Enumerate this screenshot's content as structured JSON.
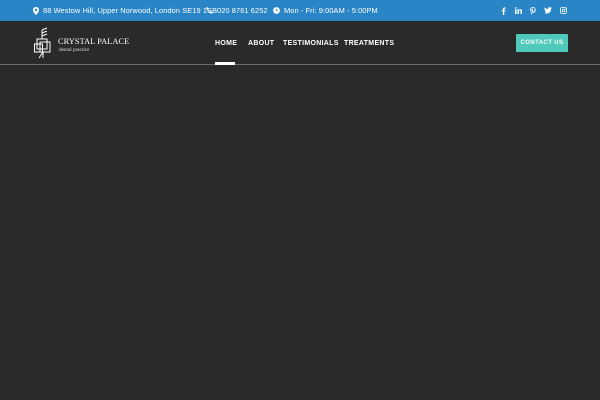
{
  "topbar": {
    "address": "88 Westow Hill, Upper Norwood, London SE19 1SB",
    "phone": "020 8761 6252",
    "hours": "Mon - Fri: 9:00AM - 5:00PM",
    "social": [
      "facebook-icon",
      "linkedin-icon",
      "pinterest-icon",
      "twitter-icon",
      "instagram-icon"
    ]
  },
  "header": {
    "logo_title": "CRYSTAL PALACE",
    "logo_subtitle": "dental practice",
    "nav": [
      "HOME",
      "ABOUT",
      "TESTIMONIALS",
      "TREATMENTS"
    ],
    "active_nav": "HOME",
    "cta_label": "CONTACT US"
  },
  "colors": {
    "topbar_bg": "#2a85c6",
    "page_bg": "#2a2a2a",
    "accent": "#4fc9bb"
  }
}
